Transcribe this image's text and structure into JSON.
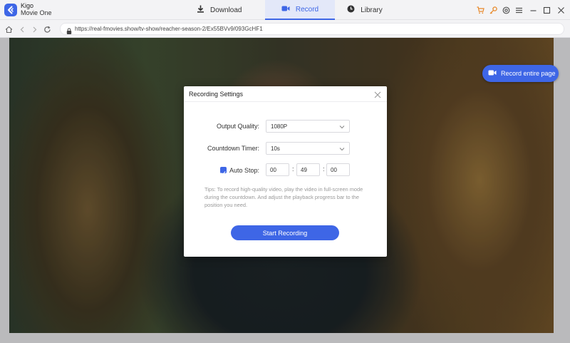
{
  "app": {
    "name_line1": "Kigo",
    "name_line2": "Movie One"
  },
  "tabs": [
    {
      "label": "Download",
      "icon": "download-icon"
    },
    {
      "label": "Record",
      "icon": "video-camera-icon"
    },
    {
      "label": "Library",
      "icon": "clock-icon"
    }
  ],
  "title_controls": [
    "cart-icon",
    "key-icon",
    "settings-icon",
    "menu-icon",
    "minimize-icon",
    "maximize-icon",
    "close-icon"
  ],
  "address": {
    "url": "https://real-fmovies.show/tv-show/reacher-season-2/Ex55BVv9/093GcHF1"
  },
  "record_entire_page": {
    "label": "Record entire page"
  },
  "dialog": {
    "title": "Recording Settings",
    "output_quality": {
      "label": "Output Quality:",
      "value": "1080P"
    },
    "countdown_timer": {
      "label": "Countdown Timer:",
      "value": "10s"
    },
    "auto_stop": {
      "label": "Auto Stop:",
      "checked": true,
      "hours": "00",
      "minutes": "49",
      "seconds": "00",
      "separator": ":"
    },
    "tips": "Tips: To record high-quality video, play the video in full-screen mode during the countdown. And adjust the playback progress bar to the position you need.",
    "start_button": "Start Recording"
  },
  "colors": {
    "accent": "#3e66e6",
    "tab_active_bg": "#e3e8f9"
  }
}
